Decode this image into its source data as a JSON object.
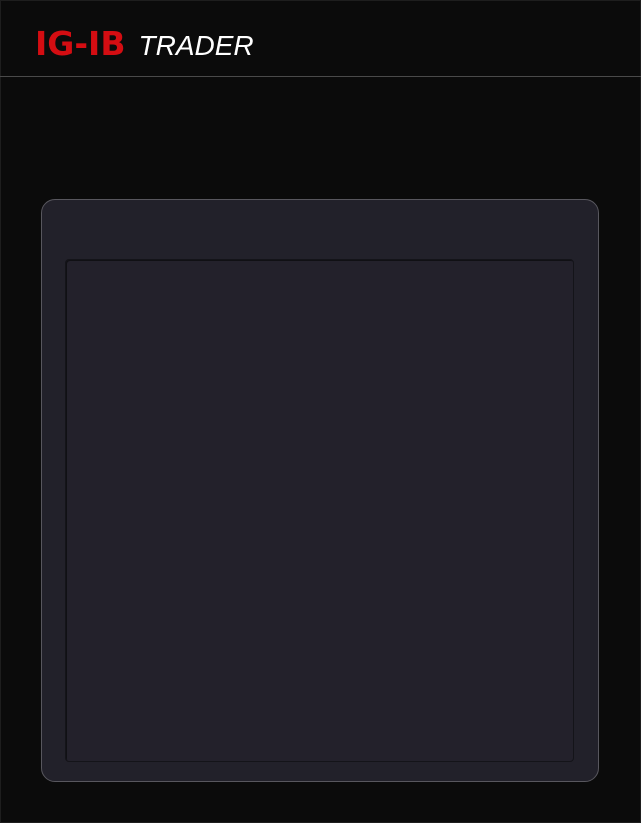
{
  "header": {
    "logo_brand": "IG-IB",
    "logo_product": "TRADER"
  },
  "colors": {
    "background": "#0b0b0b",
    "brand_red": "#d40d12",
    "logo_product_text": "#ffffff",
    "card_background": "#22212a",
    "card_border": "#58575e",
    "header_divider": "#4a4a4a"
  },
  "main": {
    "panel": {
      "content": ""
    }
  }
}
